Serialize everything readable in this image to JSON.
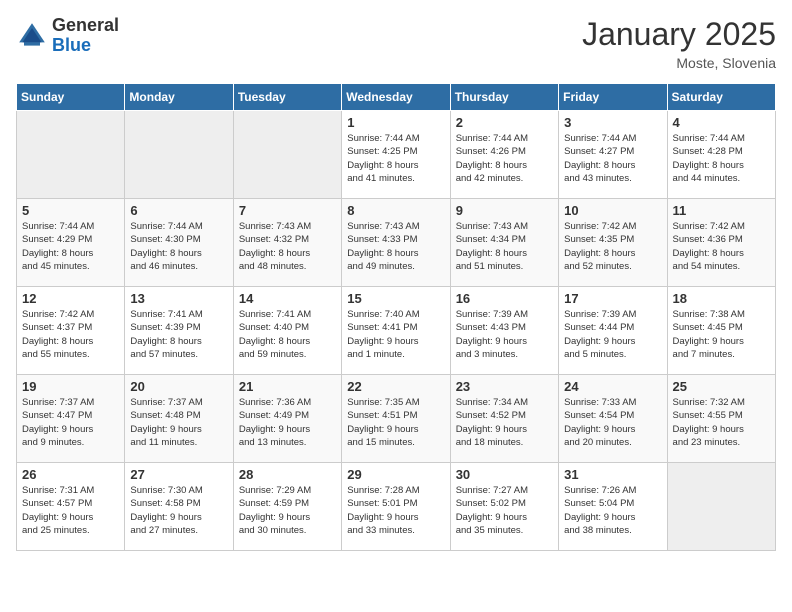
{
  "header": {
    "logo_general": "General",
    "logo_blue": "Blue",
    "month_title": "January 2025",
    "location": "Moste, Slovenia"
  },
  "weekdays": [
    "Sunday",
    "Monday",
    "Tuesday",
    "Wednesday",
    "Thursday",
    "Friday",
    "Saturday"
  ],
  "weeks": [
    [
      {
        "day": "",
        "info": ""
      },
      {
        "day": "",
        "info": ""
      },
      {
        "day": "",
        "info": ""
      },
      {
        "day": "1",
        "info": "Sunrise: 7:44 AM\nSunset: 4:25 PM\nDaylight: 8 hours\nand 41 minutes."
      },
      {
        "day": "2",
        "info": "Sunrise: 7:44 AM\nSunset: 4:26 PM\nDaylight: 8 hours\nand 42 minutes."
      },
      {
        "day": "3",
        "info": "Sunrise: 7:44 AM\nSunset: 4:27 PM\nDaylight: 8 hours\nand 43 minutes."
      },
      {
        "day": "4",
        "info": "Sunrise: 7:44 AM\nSunset: 4:28 PM\nDaylight: 8 hours\nand 44 minutes."
      }
    ],
    [
      {
        "day": "5",
        "info": "Sunrise: 7:44 AM\nSunset: 4:29 PM\nDaylight: 8 hours\nand 45 minutes."
      },
      {
        "day": "6",
        "info": "Sunrise: 7:44 AM\nSunset: 4:30 PM\nDaylight: 8 hours\nand 46 minutes."
      },
      {
        "day": "7",
        "info": "Sunrise: 7:43 AM\nSunset: 4:32 PM\nDaylight: 8 hours\nand 48 minutes."
      },
      {
        "day": "8",
        "info": "Sunrise: 7:43 AM\nSunset: 4:33 PM\nDaylight: 8 hours\nand 49 minutes."
      },
      {
        "day": "9",
        "info": "Sunrise: 7:43 AM\nSunset: 4:34 PM\nDaylight: 8 hours\nand 51 minutes."
      },
      {
        "day": "10",
        "info": "Sunrise: 7:42 AM\nSunset: 4:35 PM\nDaylight: 8 hours\nand 52 minutes."
      },
      {
        "day": "11",
        "info": "Sunrise: 7:42 AM\nSunset: 4:36 PM\nDaylight: 8 hours\nand 54 minutes."
      }
    ],
    [
      {
        "day": "12",
        "info": "Sunrise: 7:42 AM\nSunset: 4:37 PM\nDaylight: 8 hours\nand 55 minutes."
      },
      {
        "day": "13",
        "info": "Sunrise: 7:41 AM\nSunset: 4:39 PM\nDaylight: 8 hours\nand 57 minutes."
      },
      {
        "day": "14",
        "info": "Sunrise: 7:41 AM\nSunset: 4:40 PM\nDaylight: 8 hours\nand 59 minutes."
      },
      {
        "day": "15",
        "info": "Sunrise: 7:40 AM\nSunset: 4:41 PM\nDaylight: 9 hours\nand 1 minute."
      },
      {
        "day": "16",
        "info": "Sunrise: 7:39 AM\nSunset: 4:43 PM\nDaylight: 9 hours\nand 3 minutes."
      },
      {
        "day": "17",
        "info": "Sunrise: 7:39 AM\nSunset: 4:44 PM\nDaylight: 9 hours\nand 5 minutes."
      },
      {
        "day": "18",
        "info": "Sunrise: 7:38 AM\nSunset: 4:45 PM\nDaylight: 9 hours\nand 7 minutes."
      }
    ],
    [
      {
        "day": "19",
        "info": "Sunrise: 7:37 AM\nSunset: 4:47 PM\nDaylight: 9 hours\nand 9 minutes."
      },
      {
        "day": "20",
        "info": "Sunrise: 7:37 AM\nSunset: 4:48 PM\nDaylight: 9 hours\nand 11 minutes."
      },
      {
        "day": "21",
        "info": "Sunrise: 7:36 AM\nSunset: 4:49 PM\nDaylight: 9 hours\nand 13 minutes."
      },
      {
        "day": "22",
        "info": "Sunrise: 7:35 AM\nSunset: 4:51 PM\nDaylight: 9 hours\nand 15 minutes."
      },
      {
        "day": "23",
        "info": "Sunrise: 7:34 AM\nSunset: 4:52 PM\nDaylight: 9 hours\nand 18 minutes."
      },
      {
        "day": "24",
        "info": "Sunrise: 7:33 AM\nSunset: 4:54 PM\nDaylight: 9 hours\nand 20 minutes."
      },
      {
        "day": "25",
        "info": "Sunrise: 7:32 AM\nSunset: 4:55 PM\nDaylight: 9 hours\nand 23 minutes."
      }
    ],
    [
      {
        "day": "26",
        "info": "Sunrise: 7:31 AM\nSunset: 4:57 PM\nDaylight: 9 hours\nand 25 minutes."
      },
      {
        "day": "27",
        "info": "Sunrise: 7:30 AM\nSunset: 4:58 PM\nDaylight: 9 hours\nand 27 minutes."
      },
      {
        "day": "28",
        "info": "Sunrise: 7:29 AM\nSunset: 4:59 PM\nDaylight: 9 hours\nand 30 minutes."
      },
      {
        "day": "29",
        "info": "Sunrise: 7:28 AM\nSunset: 5:01 PM\nDaylight: 9 hours\nand 33 minutes."
      },
      {
        "day": "30",
        "info": "Sunrise: 7:27 AM\nSunset: 5:02 PM\nDaylight: 9 hours\nand 35 minutes."
      },
      {
        "day": "31",
        "info": "Sunrise: 7:26 AM\nSunset: 5:04 PM\nDaylight: 9 hours\nand 38 minutes."
      },
      {
        "day": "",
        "info": ""
      }
    ]
  ]
}
